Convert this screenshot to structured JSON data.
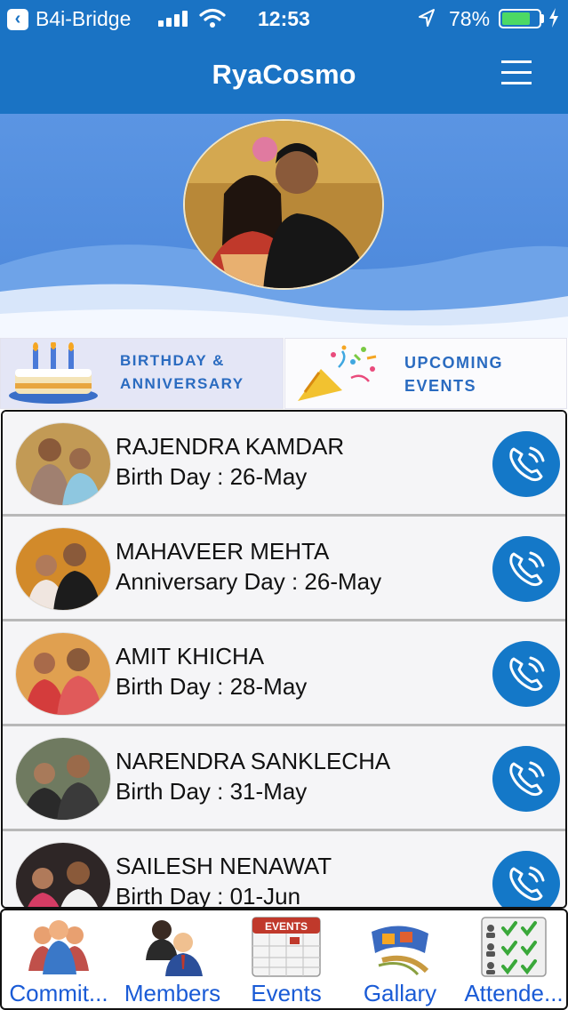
{
  "status_bar": {
    "back_app": "B4i-Bridge",
    "time": "12:53",
    "battery": "78%",
    "battery_level": 0.78,
    "icons": [
      "back-app-icon",
      "signal-icon",
      "wifi-icon",
      "location-arrow-icon",
      "battery-icon",
      "charging-bolt-icon"
    ]
  },
  "header": {
    "title": "RyaCosmo",
    "menu_icon": "hamburger-menu-icon"
  },
  "banner": {
    "profile_image": "couple-profile-photo"
  },
  "features": {
    "birthday": {
      "line1": "BIRTHDAY &",
      "line2": "ANNIVERSARY",
      "icon": "birthday-cake-icon"
    },
    "upcoming": {
      "line1": "UPCOMING",
      "line2": "EVENTS",
      "icon": "party-popper-icon"
    }
  },
  "members": [
    {
      "name": "RAJENDRA KAMDAR",
      "occasion": "Birth Day : 26-May"
    },
    {
      "name": "MAHAVEER MEHTA",
      "occasion": "Anniversary Day : 26-May"
    },
    {
      "name": "AMIT KHICHA",
      "occasion": "Birth Day : 28-May"
    },
    {
      "name": "NARENDRA SANKLECHA",
      "occasion": "Birth Day : 31-May"
    },
    {
      "name": "SAILESH NENAWAT",
      "occasion": "Birth Day : 01-Jun"
    }
  ],
  "tabs": [
    {
      "label": "Commit...",
      "icon": "committee-icon"
    },
    {
      "label": "Members",
      "icon": "members-icon"
    },
    {
      "label": "Events",
      "icon": "events-calendar-icon",
      "badge": "EVENTS"
    },
    {
      "label": "Gallary",
      "icon": "gallery-film-icon"
    },
    {
      "label": "Attende...",
      "icon": "attendance-checklist-icon"
    }
  ],
  "colors": {
    "primary": "#1a73c4",
    "banner": "#4a86da",
    "call_button": "#1478c8",
    "tab_label": "#1a5bd6",
    "feature_text": "#2a6bc0"
  }
}
